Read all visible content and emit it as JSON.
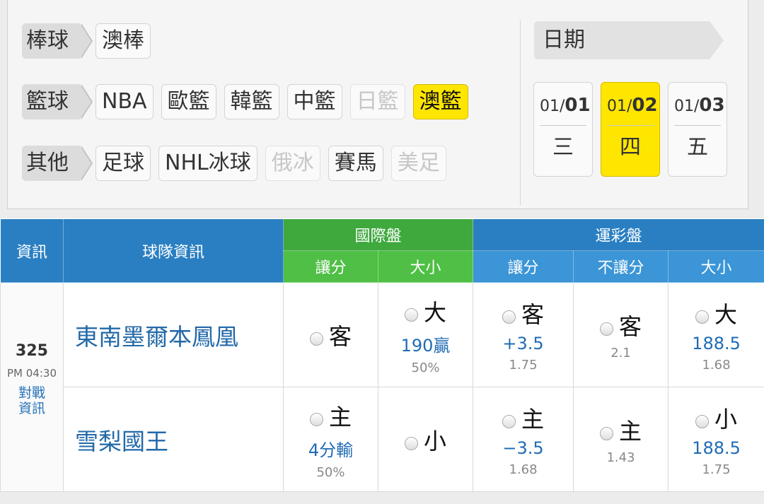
{
  "filters": {
    "baseball": {
      "category": "棒球",
      "items": [
        {
          "label": "澳棒",
          "state": "normal"
        }
      ]
    },
    "basketball": {
      "category": "籃球",
      "items": [
        {
          "label": "NBA",
          "state": "normal"
        },
        {
          "label": "歐籃",
          "state": "normal"
        },
        {
          "label": "韓籃",
          "state": "normal"
        },
        {
          "label": "中籃",
          "state": "normal"
        },
        {
          "label": "日籃",
          "state": "disabled"
        },
        {
          "label": "澳籃",
          "state": "active"
        }
      ]
    },
    "other": {
      "category": "其他",
      "items": [
        {
          "label": "足球",
          "state": "normal"
        },
        {
          "label": "NHL冰球",
          "state": "normal"
        },
        {
          "label": "俄冰",
          "state": "disabled"
        },
        {
          "label": "賽馬",
          "state": "normal"
        },
        {
          "label": "美足",
          "state": "disabled"
        }
      ]
    }
  },
  "date_panel": {
    "title": "日期",
    "dates": [
      {
        "month": "01/",
        "day": "01",
        "weekday": "三",
        "active": false
      },
      {
        "month": "01/",
        "day": "02",
        "weekday": "四",
        "active": true
      },
      {
        "month": "01/",
        "day": "03",
        "weekday": "五",
        "active": false
      }
    ]
  },
  "table": {
    "headers": {
      "info": "資訊",
      "team_info": "球隊資訊",
      "intl": "國際盤",
      "intl_handicap": "讓分",
      "intl_total": "大小",
      "lottery": "運彩盤",
      "lottery_handicap": "讓分",
      "lottery_moneyline": "不讓分",
      "lottery_total": "大小"
    },
    "colors": {
      "blue_header": "#2a7fc2",
      "green_header": "#3fa93e",
      "highlight": "#ffe600",
      "link": "#2369a8"
    },
    "game": {
      "number": "325",
      "time": "PM 04:30",
      "versus_label_1": "對戰",
      "versus_label_2": "資訊",
      "away": {
        "team": "東南墨爾本鳳凰",
        "intl_handicap": {
          "side": "客",
          "line": "",
          "pct": ""
        },
        "intl_total": {
          "side": "大",
          "line": "190贏",
          "pct": "50%"
        },
        "lottery_handicap": {
          "side": "客",
          "line": "+3.5",
          "odds": "1.75"
        },
        "lottery_moneyline": {
          "side": "客",
          "odds": "2.1"
        },
        "lottery_total": {
          "side": "大",
          "line": "188.5",
          "odds": "1.68"
        }
      },
      "home": {
        "team": "雪梨國王",
        "intl_handicap": {
          "side": "主",
          "line": "4分輸",
          "pct": "50%"
        },
        "intl_total": {
          "side": "小",
          "line": "",
          "pct": ""
        },
        "lottery_handicap": {
          "side": "主",
          "line": "−3.5",
          "odds": "1.68"
        },
        "lottery_moneyline": {
          "side": "主",
          "odds": "1.43"
        },
        "lottery_total": {
          "side": "小",
          "line": "188.5",
          "odds": "1.75"
        }
      }
    }
  }
}
